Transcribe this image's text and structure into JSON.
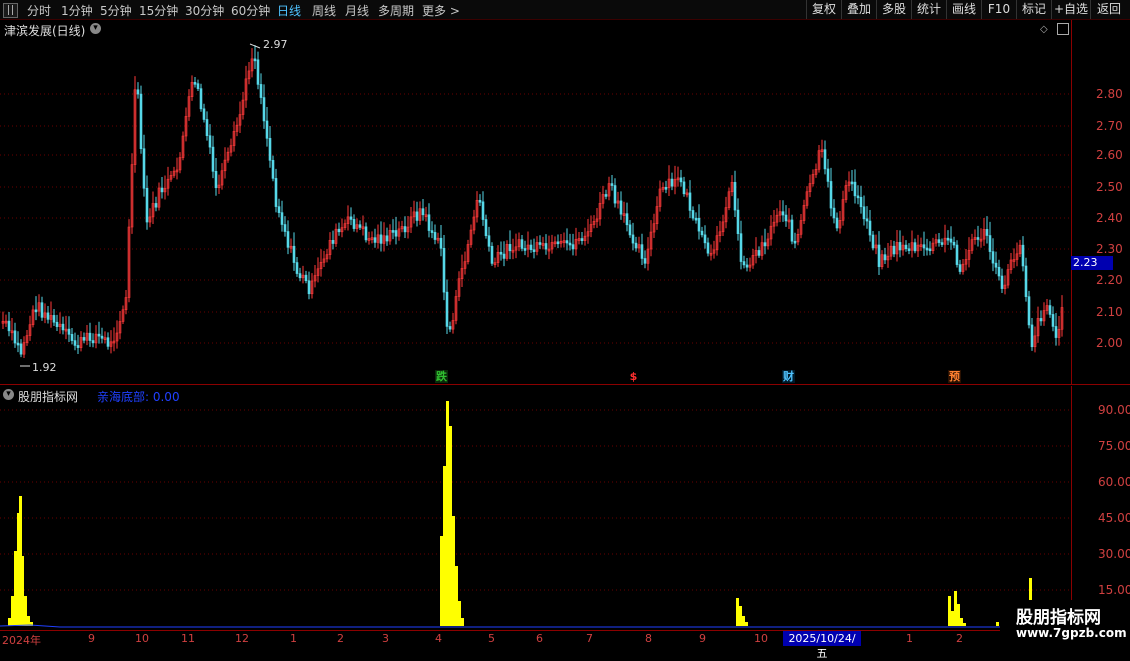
{
  "toolbar": {
    "periods": [
      "分时",
      "1分钟",
      "5分钟",
      "15分钟",
      "30分钟",
      "60分钟",
      "日线",
      "周线",
      "月线",
      "多周期",
      "更多"
    ],
    "active_period": "日线",
    "buttons": [
      "复权",
      "叠加",
      "多股",
      "统计",
      "画线",
      "F10",
      "标记",
      "+自选",
      "返回"
    ]
  },
  "chart": {
    "stock_title": "津滨发展(日线)",
    "high_label": "2.97",
    "low_label": "1.92",
    "current_price": "2.23",
    "price_ticks": [
      "2.80",
      "2.70",
      "2.60",
      "2.50",
      "2.40",
      "2.30",
      "2.20",
      "2.10",
      "2.00"
    ],
    "events": [
      {
        "label": "跌",
        "color": "#30c030",
        "bg": "#0a2a0a"
      },
      {
        "label": "$",
        "color": "#ff3030",
        "bg": "#000"
      },
      {
        "label": "财",
        "color": "#4fc3ff",
        "bg": "#001a2a"
      },
      {
        "label": "预",
        "color": "#ff8030",
        "bg": "#2a1000"
      }
    ]
  },
  "indicator": {
    "title": "股朋指标网",
    "value_label": "亲海底部: 0.00",
    "ticks": [
      "90.00",
      "75.00",
      "60.00",
      "45.00",
      "30.00",
      "15.00"
    ]
  },
  "date_axis": {
    "months": [
      "2024年",
      "9",
      "10",
      "11",
      "12",
      "1",
      "2",
      "3",
      "4",
      "5",
      "6",
      "7",
      "8",
      "9",
      "10",
      "1",
      "2"
    ],
    "cursor_date": "2025/10/24/五"
  },
  "watermark": {
    "name": "股朋指标网",
    "url": "www.7gpzb.com"
  },
  "colors": {
    "up": "#ff3a3a",
    "down": "#56d8e8",
    "volume": "#ffff00",
    "axis": "#d04040",
    "line": "#2040ff"
  }
}
